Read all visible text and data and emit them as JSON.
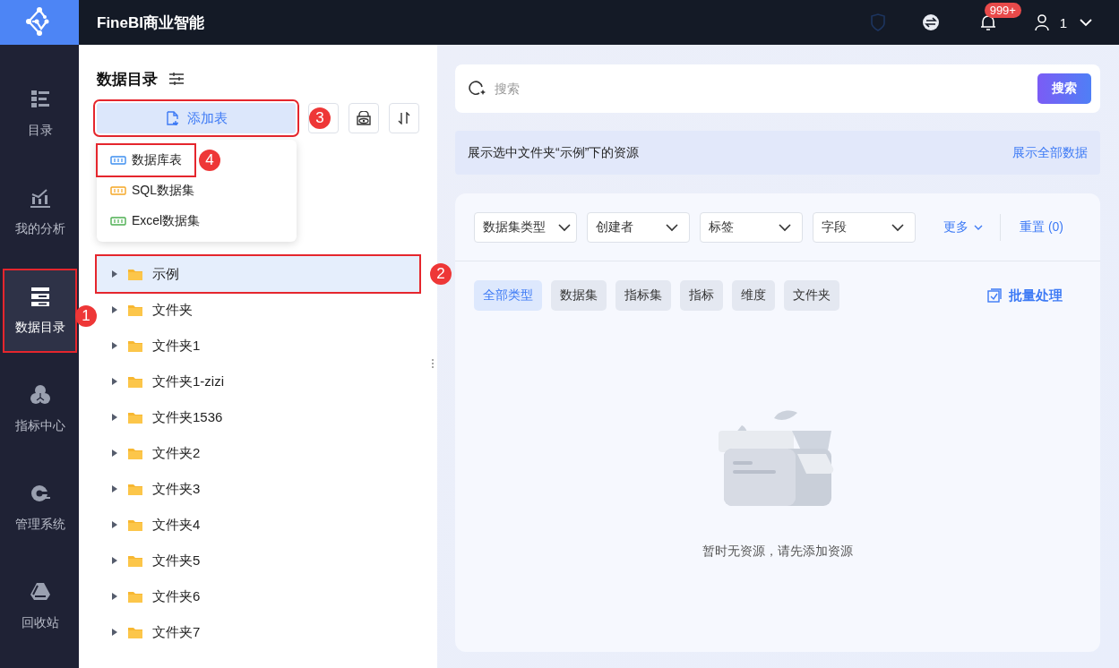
{
  "app": {
    "title": "FineBI商业智能",
    "notification_count": "999+",
    "user": "1"
  },
  "nav": [
    {
      "label": "目录",
      "selected": false
    },
    {
      "label": "我的分析",
      "selected": false
    },
    {
      "label": "数据目录",
      "selected": true,
      "callout": "1"
    },
    {
      "label": "指标中心",
      "selected": false
    },
    {
      "label": "管理系统",
      "selected": false
    },
    {
      "label": "回收站",
      "selected": false
    }
  ],
  "panel": {
    "title": "数据目录",
    "add_button": {
      "label": "添加表",
      "callout": "3"
    },
    "add_menu": [
      {
        "label": "数据库表",
        "kind": "db",
        "callout": "4"
      },
      {
        "label": "SQL数据集",
        "kind": "sql"
      },
      {
        "label": "Excel数据集",
        "kind": "xls"
      }
    ],
    "tree": [
      {
        "label": "示例",
        "selected": true,
        "callout": "2"
      },
      {
        "label": "文件夹",
        "selected": false
      },
      {
        "label": "文件夹1",
        "selected": false
      },
      {
        "label": "文件夹1-zizi",
        "selected": false
      },
      {
        "label": "文件夹1536",
        "selected": false
      },
      {
        "label": "文件夹2",
        "selected": false
      },
      {
        "label": "文件夹3",
        "selected": false
      },
      {
        "label": "文件夹4",
        "selected": false
      },
      {
        "label": "文件夹5",
        "selected": false
      },
      {
        "label": "文件夹6",
        "selected": false
      },
      {
        "label": "文件夹7",
        "selected": false
      }
    ]
  },
  "search": {
    "placeholder": "搜索",
    "button": "搜索"
  },
  "info_bar": {
    "text": "展示选中文件夹“示例”下的资源",
    "link": "展示全部数据"
  },
  "filters": [
    {
      "label": "数据集类型"
    },
    {
      "label": "创建者"
    },
    {
      "label": "标签"
    },
    {
      "label": "字段"
    }
  ],
  "more": "更多",
  "reset": "重置 (0)",
  "types": [
    {
      "label": "全部类型",
      "selected": true
    },
    {
      "label": "数据集",
      "selected": false
    },
    {
      "label": "指标集",
      "selected": false
    },
    {
      "label": "指标",
      "selected": false
    },
    {
      "label": "维度",
      "selected": false
    },
    {
      "label": "文件夹",
      "selected": false
    }
  ],
  "batch": "批量处理",
  "empty_text": "暂时无资源，请先添加资源"
}
